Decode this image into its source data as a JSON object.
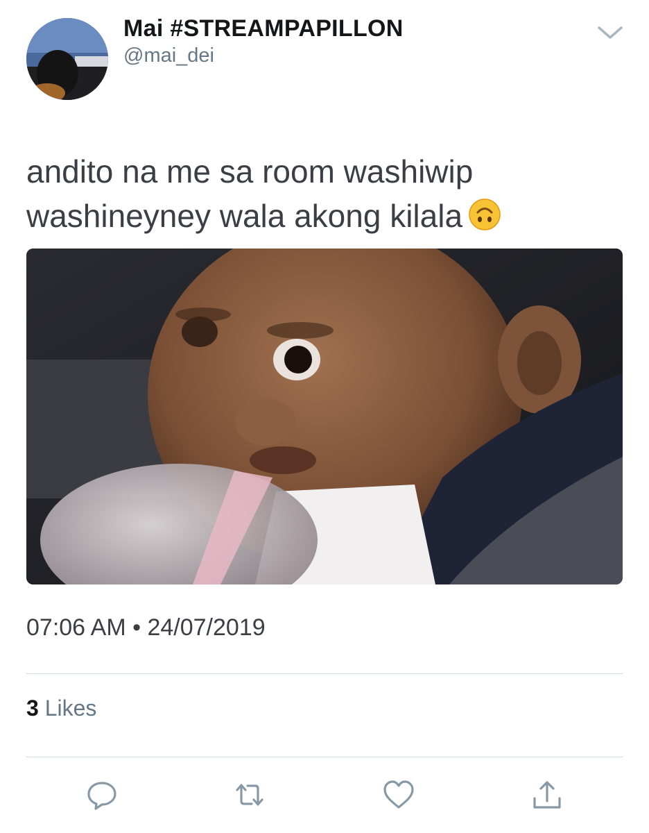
{
  "author": {
    "display_name": "Mai #STREAMPAPILLON",
    "handle": "@mai_dei"
  },
  "tweet": {
    "text": "andito na me sa room washiwip washineyney wala akong kilala",
    "emoji": "upside-down-face-emoji"
  },
  "media": {
    "description_icon": "photo"
  },
  "meta": {
    "time": "07:06 AM",
    "separator": "•",
    "date": "24/07/2019"
  },
  "stats": {
    "likes_count": "3",
    "likes_label": "Likes"
  },
  "actions": {
    "reply_icon": "reply-icon",
    "retweet_icon": "retweet-icon",
    "like_icon": "heart-icon",
    "share_icon": "share-icon"
  },
  "colors": {
    "secondary_text": "#657786",
    "icon": "#8899a6",
    "divider": "#d6dbe0"
  }
}
